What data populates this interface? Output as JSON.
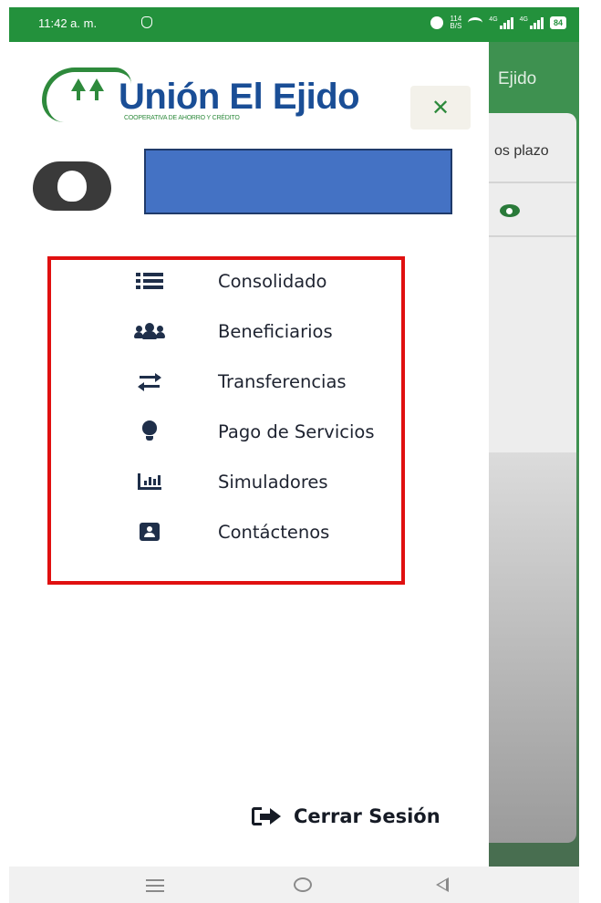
{
  "status_bar": {
    "time": "11:42 a. m.",
    "net_speed_value": "114",
    "net_speed_unit": "B/S",
    "signal1_label": "4G",
    "signal2_label": "4G",
    "battery": "84",
    "icons": [
      "shield-icon",
      "alarm-icon",
      "wifi-icon",
      "signal-icon",
      "battery-icon"
    ]
  },
  "background_app": {
    "title": "Ejido",
    "tab_label": "os plazo"
  },
  "drawer": {
    "logo": {
      "name": "Unión El Ejido",
      "tagline": "COOPERATIVA DE AHORRO Y CRÉDITO"
    },
    "close_label": "✕",
    "menu": [
      {
        "label": "Consolidado",
        "icon": "list-icon"
      },
      {
        "label": "Beneficiarios",
        "icon": "users-icon"
      },
      {
        "label": "Transferencias",
        "icon": "exchange-icon"
      },
      {
        "label": "Pago de Servicios",
        "icon": "lightbulb-icon"
      },
      {
        "label": "Simuladores",
        "icon": "bar-chart-icon"
      },
      {
        "label": "Contáctenos",
        "icon": "contact-card-icon"
      }
    ],
    "logout_label": "Cerrar Sesión"
  },
  "colors": {
    "brand_green": "#2e8a3c",
    "brand_blue": "#1a4e96",
    "status_green": "#23913c",
    "highlight_red": "#e01010",
    "redaction_blue": "#4472c4"
  }
}
